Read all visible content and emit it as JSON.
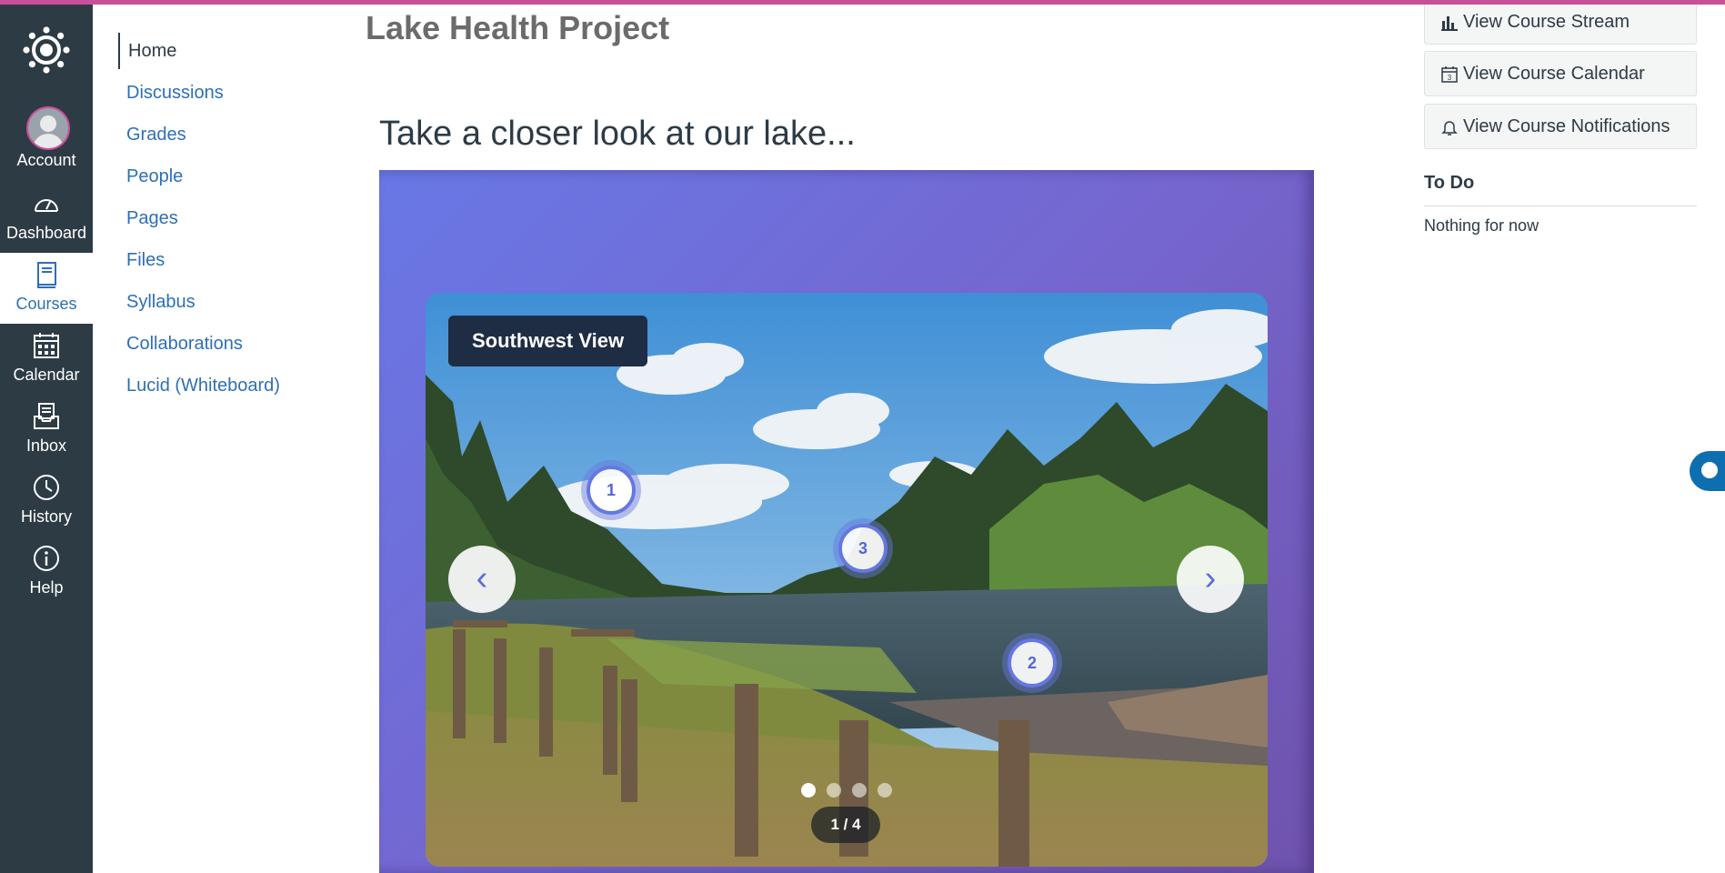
{
  "global_nav": {
    "items": [
      {
        "label": "Account",
        "icon": "user-avatar-icon"
      },
      {
        "label": "Dashboard",
        "icon": "speedometer-icon"
      },
      {
        "label": "Courses",
        "icon": "book-icon",
        "active": true
      },
      {
        "label": "Calendar",
        "icon": "calendar-icon"
      },
      {
        "label": "Inbox",
        "icon": "inbox-icon"
      },
      {
        "label": "History",
        "icon": "clock-icon"
      },
      {
        "label": "Help",
        "icon": "info-icon"
      }
    ]
  },
  "course_nav": {
    "items": [
      "Home",
      "Discussions",
      "Grades",
      "People",
      "Pages",
      "Files",
      "Syllabus",
      "Collaborations",
      "Lucid (Whiteboard)"
    ],
    "active": "Home"
  },
  "main": {
    "course_title": "Lake Health Project",
    "heading": "Take a closer look at our lake...",
    "carousel": {
      "view_label": "Southwest View",
      "hotspots": [
        "1",
        "3",
        "2"
      ],
      "prev": "‹",
      "next": "›",
      "counter": "1 / 4",
      "slides": 4,
      "current": 1
    }
  },
  "sidebar": {
    "buttons": [
      {
        "label": "View Course Stream",
        "icon": "bar-chart-icon"
      },
      {
        "label": "View Course Calendar",
        "icon": "calendar-icon"
      },
      {
        "label": "View Course Notifications",
        "icon": "bell-icon"
      }
    ],
    "todo_title": "To Do",
    "todo_empty": "Nothing for now"
  },
  "colors": {
    "nav_bg": "#2d3b45",
    "link": "#2d6fb6",
    "accent_top": "#c94f9a",
    "stage_gradient_start": "#6878e6",
    "stage_gradient_end": "#6f53ad",
    "label_bg": "#1f2d44"
  }
}
